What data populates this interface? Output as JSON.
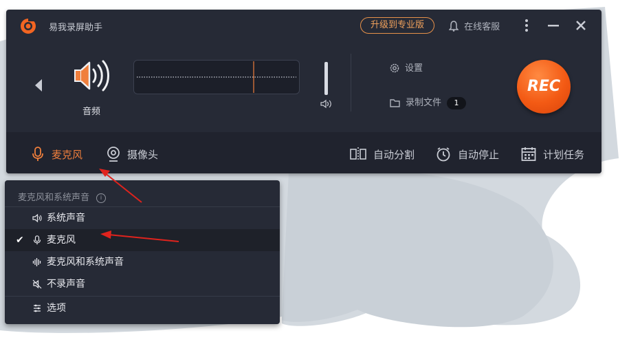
{
  "app": {
    "title": "易我录屏助手"
  },
  "titlebar": {
    "upgrade_label": "升级到专业版",
    "service_label": "在线客服"
  },
  "audio": {
    "label": "音频",
    "volume_level": 1.0
  },
  "side_links": {
    "settings_label": "设置",
    "files_label": "录制文件",
    "files_count": "1"
  },
  "rec": {
    "label": "REC"
  },
  "bottom_bar": {
    "microphone_label": "麦克风",
    "camera_label": "摄像头",
    "auto_split_label": "自动分割",
    "auto_stop_label": "自动停止",
    "schedule_label": "计划任务"
  },
  "dropdown": {
    "header": "麦克风和系统声音",
    "info_glyph": "i",
    "items": [
      {
        "label": "系统声音",
        "icon": "speaker-icon",
        "selected": false
      },
      {
        "label": "麦克风",
        "icon": "microphone-icon",
        "selected": true
      },
      {
        "label": "麦克风和系统声音",
        "icon": "waveform-icon",
        "selected": false
      },
      {
        "label": "不录声音",
        "icon": "mute-icon",
        "selected": false
      }
    ],
    "options_label": "选项",
    "check_glyph": "✔"
  },
  "colors": {
    "window_bg": "#262a36",
    "accent_orange": "#f07f3c",
    "rec_red": "#f35a14",
    "annotation_arrow": "#e0231d"
  }
}
